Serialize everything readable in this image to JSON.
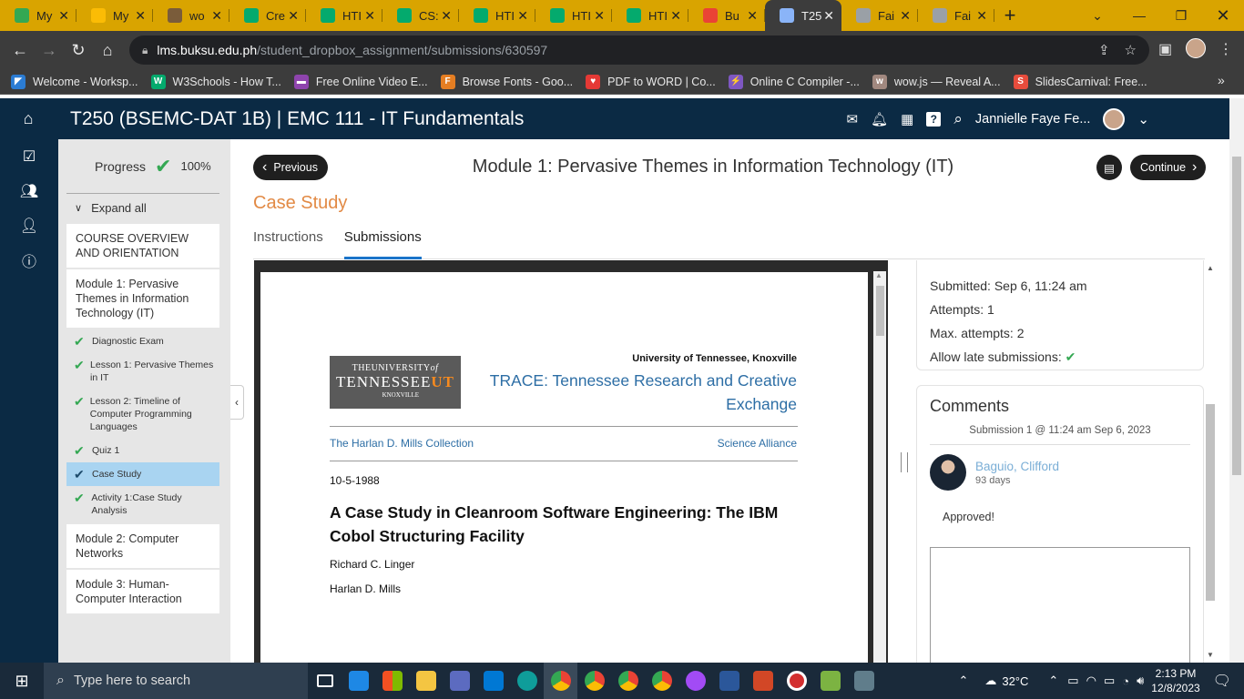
{
  "browser": {
    "tabs": [
      {
        "title": "My",
        "color": "#34a853"
      },
      {
        "title": "My",
        "color": "#fbbc05"
      },
      {
        "title": "wo",
        "color": "#7a5c3a"
      },
      {
        "title": "Cre",
        "color": "#04aa6d"
      },
      {
        "title": "HTI",
        "color": "#04aa6d"
      },
      {
        "title": "CS:",
        "color": "#04aa6d"
      },
      {
        "title": "HTI",
        "color": "#04aa6d"
      },
      {
        "title": "HTI",
        "color": "#04aa6d"
      },
      {
        "title": "HTI",
        "color": "#04aa6d"
      },
      {
        "title": "Bu",
        "color": "#ea4335"
      },
      {
        "title": "T25",
        "color": "#8ab4f8",
        "active": true
      },
      {
        "title": "Fai",
        "color": "#9aa0a6"
      },
      {
        "title": "Fai",
        "color": "#9aa0a6"
      }
    ],
    "url_host": "lms.buksu.edu.ph",
    "url_path": "/student_dropbox_assignment/submissions/630597",
    "bookmarks": [
      {
        "label": "Welcome - Worksp...",
        "color": "#2b7cd3",
        "glyph": "◤"
      },
      {
        "label": "W3Schools - How T...",
        "color": "#04aa6d",
        "glyph": "W"
      },
      {
        "label": "Free Online Video E...",
        "color": "#8e44ad",
        "glyph": "▬"
      },
      {
        "label": "Browse Fonts - Goo...",
        "color": "#e67e22",
        "glyph": "F"
      },
      {
        "label": "PDF to WORD | Co...",
        "color": "#e53935",
        "glyph": "♥"
      },
      {
        "label": "Online C Compiler -...",
        "color": "#7e57c2",
        "glyph": "⚡"
      },
      {
        "label": "wow.js — Reveal A...",
        "color": "#a1887f",
        "glyph": "w"
      },
      {
        "label": "SlidesCarnival: Free...",
        "color": "#e74c3c",
        "glyph": "S"
      }
    ]
  },
  "lms": {
    "course_title": "T250 (BSEMC-DAT 1B) | EMC 111 - IT Fundamentals",
    "user_name": "Jannielle Faye Fe...",
    "progress_label": "Progress",
    "progress_value": "100%",
    "expand_all": "Expand all",
    "sections": {
      "s0": "COURSE OVERVIEW AND ORIENTATION",
      "s1": "Module 1: Pervasive Themes in Information Technology (IT)",
      "s2": "Module 2: Computer Networks",
      "s3": "Module 3: Human-Computer Interaction"
    },
    "activities": [
      "Diagnostic Exam",
      "Lesson 1: Pervasive Themes in IT",
      "Lesson 2: Timeline of Computer Programming Languages",
      "Quiz 1",
      "Case Study",
      "Activity 1:Case Study Analysis"
    ],
    "previous_label": "Previous",
    "continue_label": "Continue",
    "page_title": "Module 1: Pervasive Themes in Information Technology (IT)",
    "activity_title": "Case Study",
    "tab_instructions": "Instructions",
    "tab_submissions": "Submissions"
  },
  "document": {
    "logo_the": "THE",
    "logo_university": "UNIVERSITY",
    "logo_of": "of",
    "logo_tennessee": "TENNESSEE",
    "logo_ut": "UT",
    "logo_knoxville": "KNOXVILLE",
    "institution": "University of Tennessee, Knoxville",
    "repository": "TRACE: Tennessee Research and Creative Exchange",
    "collection": "The Harlan D. Mills Collection",
    "alliance": "Science Alliance",
    "date": "10-5-1988",
    "title": "A Case Study in Cleanroom Software Engineering: The IBM Cobol Structuring Facility",
    "author1": "Richard C. Linger",
    "author2": "Harlan D. Mills"
  },
  "submission": {
    "submitted": "Submitted: Sep 6, 11:24 am",
    "attempts": "Attempts: 1",
    "max_attempts": "Max. attempts: 2",
    "late": "Allow late submissions:",
    "comments_title": "Comments",
    "comments_sub": "Submission 1 @ 11:24 am Sep 6, 2023",
    "commenter": "Baguio, Clifford",
    "comment_age": "93 days",
    "comment_text": "Approved!"
  },
  "taskbar": {
    "search_placeholder": "Type here to search",
    "temperature": "32°C",
    "time": "2:13 PM",
    "date": "12/8/2023"
  }
}
